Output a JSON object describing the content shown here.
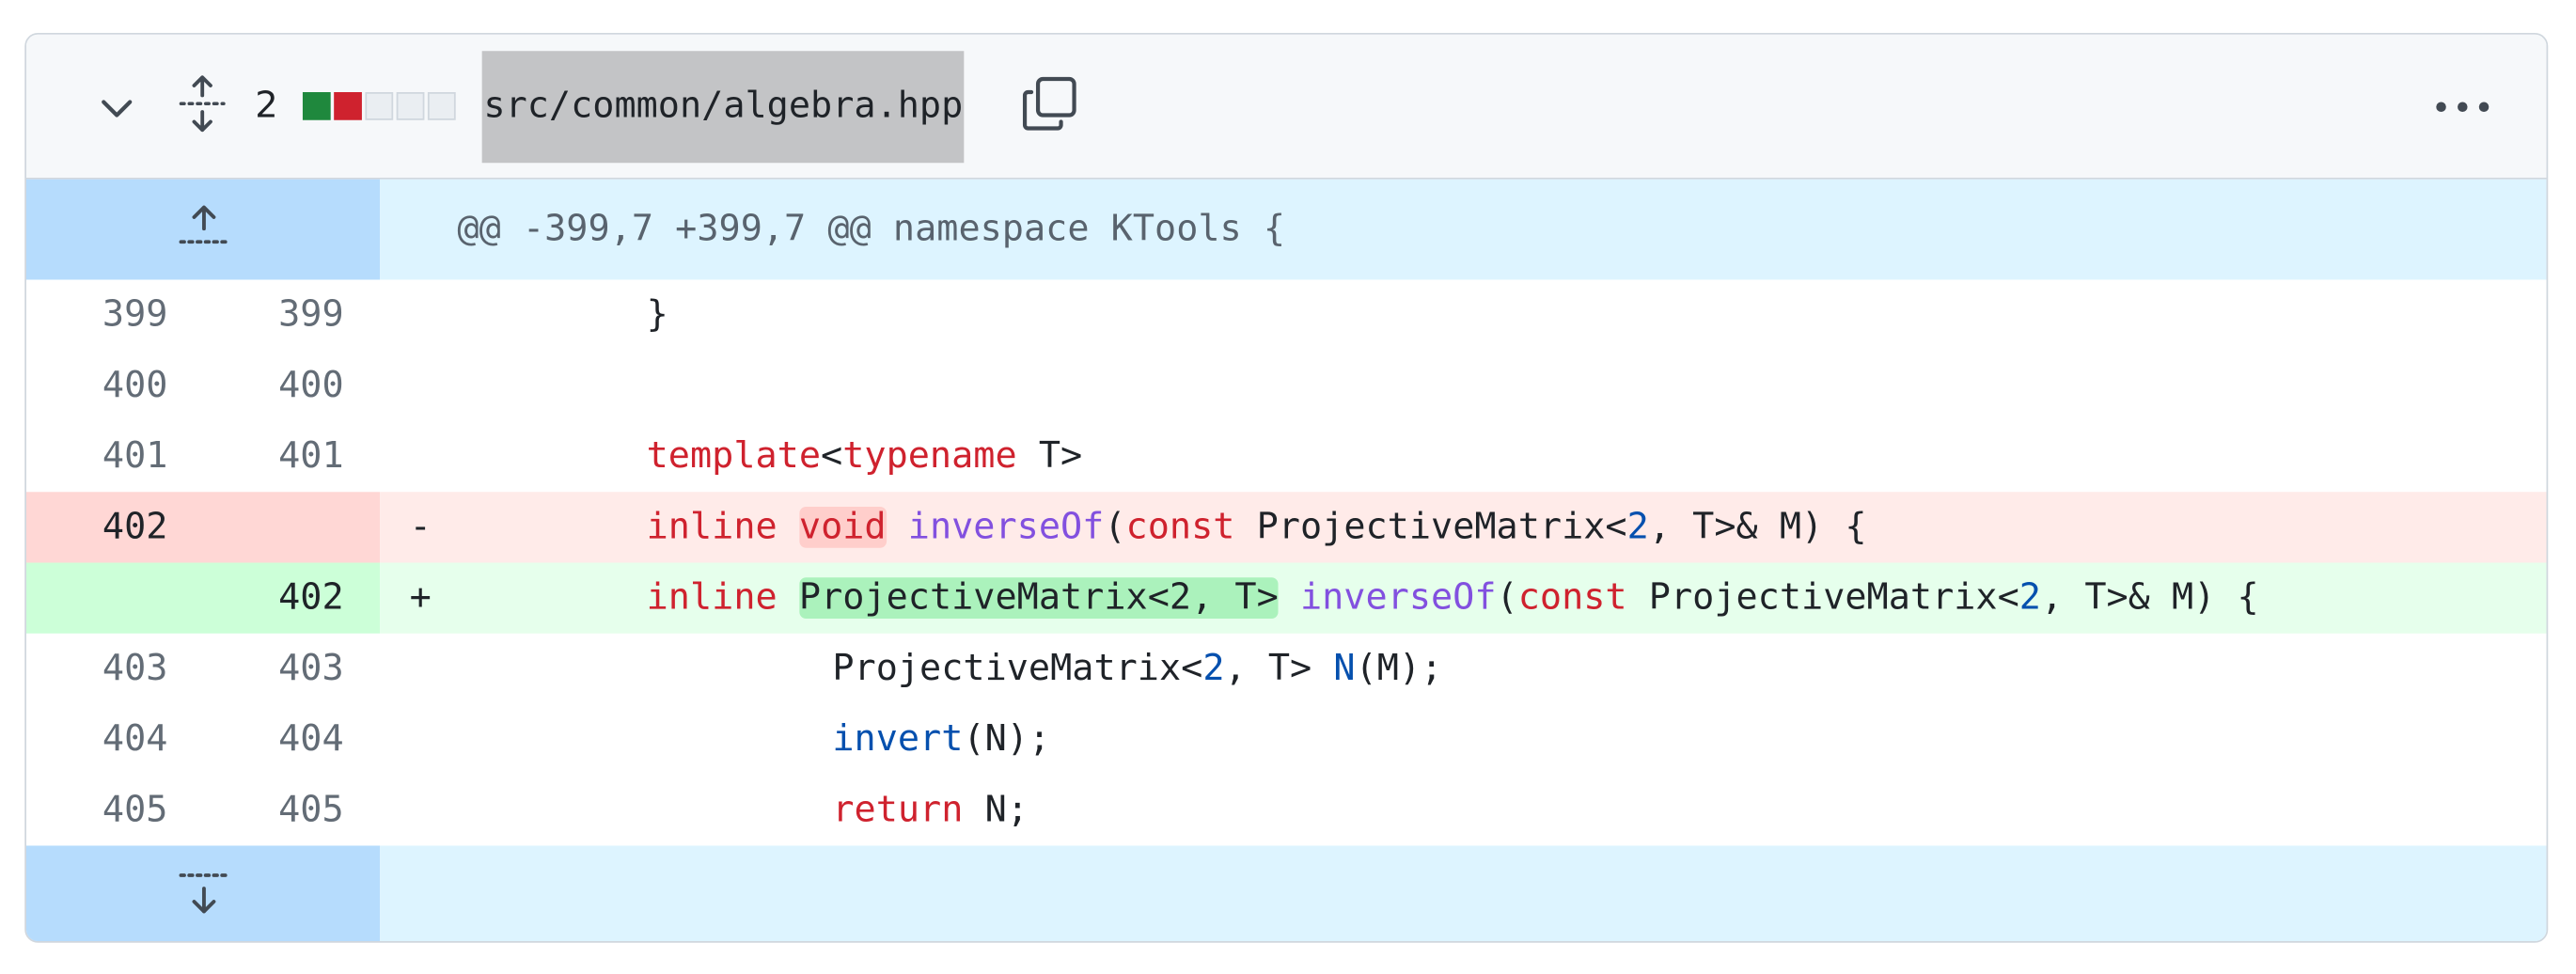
{
  "file_header": {
    "changes_count": "2",
    "file_path": "src/common/algebra.hpp",
    "diffstat_colors": [
      "#1f883d",
      "#cf222e",
      "#eaeef2",
      "#eaeef2",
      "#eaeef2"
    ]
  },
  "icons": {
    "collapse": "chevron-down-icon",
    "expand_all": "unfold-icon",
    "copy": "copy-icon",
    "more": "kebab-horizontal-icon",
    "expand_up": "fold-up-icon",
    "expand_down": "fold-down-icon"
  },
  "hunk_header": "@@ -399,7 +399,7 @@ namespace KTools {",
  "lines": [
    {
      "old": "399",
      "new": "399",
      "sign": "",
      "code": "}"
    },
    {
      "old": "400",
      "new": "400",
      "sign": "",
      "code": ""
    },
    {
      "old": "401",
      "new": "401",
      "sign": "",
      "code": "template<typename T>"
    },
    {
      "old": "402",
      "new": "",
      "sign": "-",
      "code": "inline void inverseOf(const ProjectiveMatrix<2, T>& M) {"
    },
    {
      "old": "",
      "new": "402",
      "sign": "+",
      "code": "inline ProjectiveMatrix<2, T> inverseOf(const ProjectiveMatrix<2, T>& M) {"
    },
    {
      "old": "403",
      "new": "403",
      "sign": "",
      "code": "ProjectiveMatrix<2, T> N(M);"
    },
    {
      "old": "404",
      "new": "404",
      "sign": "",
      "code": "invert(N);"
    },
    {
      "old": "405",
      "new": "405",
      "sign": "",
      "code": "return N;"
    }
  ],
  "tokens": {
    "l0": [
      "}"
    ],
    "l2": [
      "template",
      "<",
      "typename",
      " T>"
    ],
    "l3": [
      "inline",
      " ",
      "void",
      " ",
      "inverseOf",
      "(",
      "const",
      " ProjectiveMatrix<",
      "2",
      ", T>& M) {"
    ],
    "l4": [
      "inline",
      " ",
      "ProjectiveMatrix<2, T>",
      " ",
      "inverseOf",
      "(",
      "const",
      " ProjectiveMatrix<",
      "2",
      ", T>& M) {"
    ],
    "l5": [
      "ProjectiveMatrix<",
      "2",
      ", T> ",
      "N",
      "(M);"
    ],
    "l6": [
      "invert",
      "(N);"
    ],
    "l7": [
      "return",
      " N;"
    ]
  }
}
